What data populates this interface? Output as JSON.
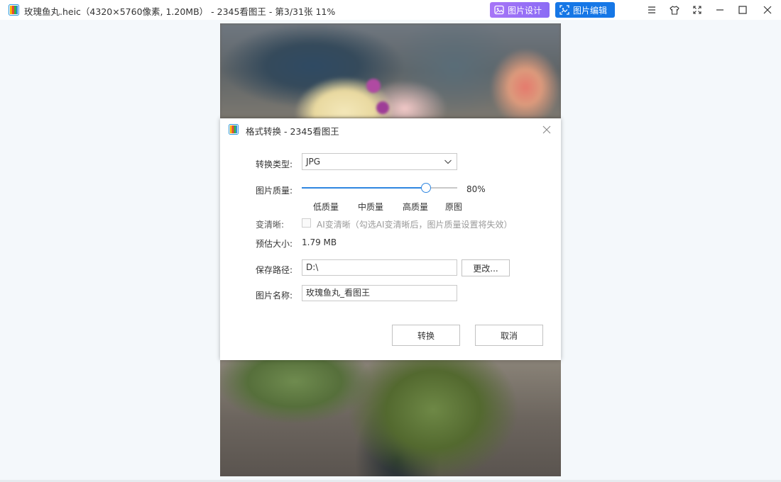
{
  "window": {
    "title": "玫瑰鱼丸.heic（4320×5760像素, 1.20MB） - 2345看图王 - 第3/31张 11%",
    "design_button": "图片设计",
    "edit_button": "图片编辑"
  },
  "dialog": {
    "title": "格式转换 - 2345看图王",
    "convert_type_label": "转换类型:",
    "convert_type_value": "JPG",
    "quality_label": "图片质量:",
    "quality_percent": 80,
    "quality_text": "80%",
    "quality_ticks": [
      "低质量",
      "中质量",
      "高质量",
      "原图"
    ],
    "sharpen_label": "变清晰:",
    "sharpen_checkbox_text": "AI变清晰（勾选AI变清晰后，图片质量设置将失效）",
    "sharpen_checked": false,
    "est_size_label": "预估大小:",
    "est_size_value": "1.79 MB",
    "save_path_label": "保存路径:",
    "save_path_value": "D:\\",
    "change_button": "更改...",
    "file_name_label": "图片名称:",
    "file_name_value": "玫瑰鱼丸_看图王",
    "convert_button": "转换",
    "cancel_button": "取消"
  },
  "colors": {
    "accent": "#2f86e0",
    "design_pill": "#a775f7",
    "edit_pill": "#1677e6"
  }
}
